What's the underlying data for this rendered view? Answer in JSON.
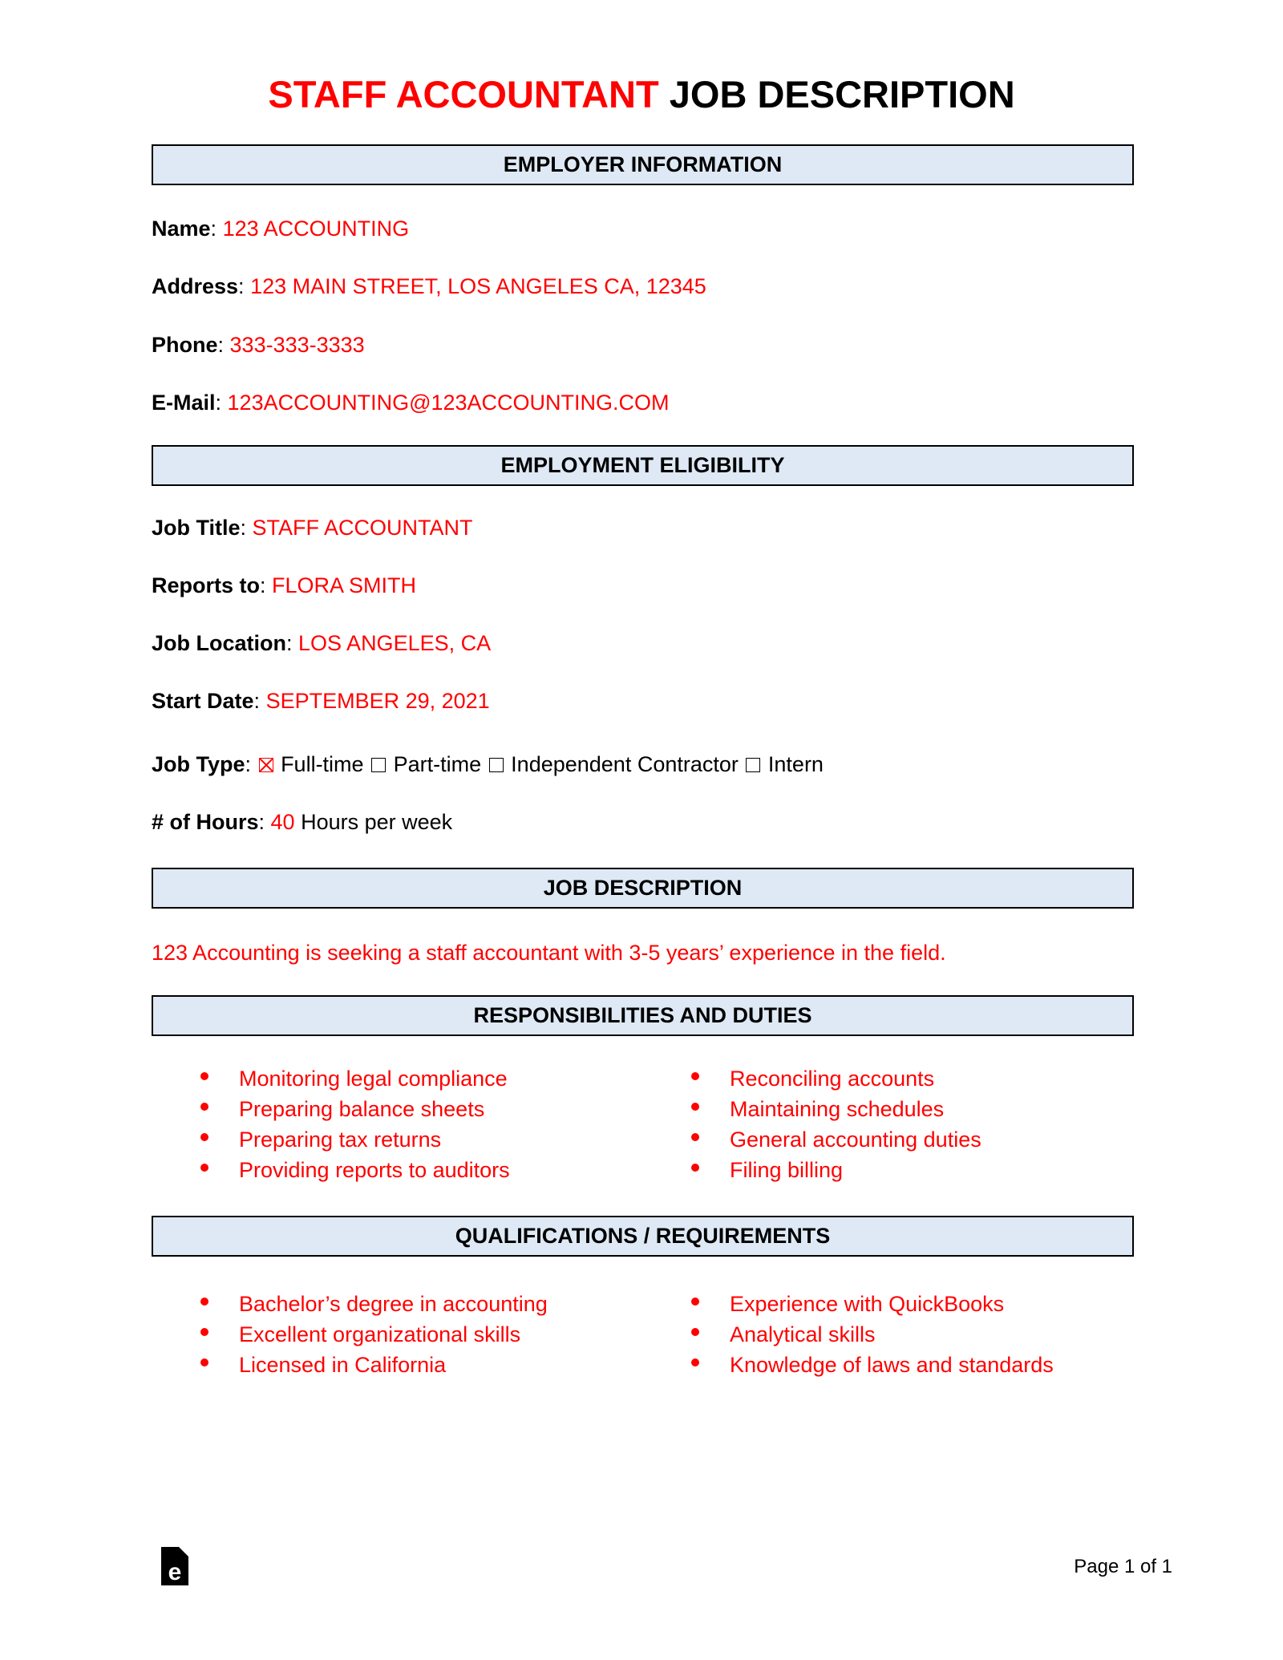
{
  "title": {
    "highlight": "STAFF ACCOUNTANT",
    "rest": " JOB DESCRIPTION"
  },
  "sections": {
    "employer": "EMPLOYER INFORMATION",
    "eligibility": "EMPLOYMENT ELIGIBILITY",
    "description": "JOB DESCRIPTION",
    "responsibilities": "RESPONSIBILITIES AND DUTIES",
    "qualifications": "QUALIFICATIONS / REQUIREMENTS"
  },
  "employer": {
    "name": {
      "label": "Name",
      "value": "123 ACCOUNTING"
    },
    "address": {
      "label": "Address",
      "value": "123 MAIN STREET, LOS ANGELES CA, 12345"
    },
    "phone": {
      "label": "Phone",
      "value": "333-333-3333"
    },
    "email": {
      "label": "E-Mail",
      "value": "123ACCOUNTING@123ACCOUNTING.COM"
    }
  },
  "eligibility": {
    "job_title": {
      "label": "Job Title",
      "value": "STAFF ACCOUNTANT"
    },
    "reports_to": {
      "label": "Reports to",
      "value": "FLORA SMITH"
    },
    "location": {
      "label": "Job Location",
      "value": "LOS ANGELES, CA"
    },
    "start_date": {
      "label": "Start Date",
      "value": "SEPTEMBER 29, 2021"
    },
    "job_type": {
      "label": "Job Type",
      "options": [
        {
          "label": "Full-time",
          "checked": true
        },
        {
          "label": "Part-time",
          "checked": false
        },
        {
          "label": "Independent Contractor",
          "checked": false
        },
        {
          "label": "Intern",
          "checked": false
        }
      ]
    },
    "hours": {
      "label": "# of Hours",
      "value": "40",
      "suffix": "Hours per week"
    }
  },
  "description": "123 Accounting is seeking a staff accountant with 3-5 years’ experience in the field.",
  "responsibilities": {
    "left": [
      "Monitoring legal compliance",
      "Preparing balance sheets",
      "Preparing tax returns",
      "Providing reports to auditors"
    ],
    "right": [
      "Reconciling accounts",
      "Maintaining schedules",
      "General accounting duties",
      "Filing billing"
    ]
  },
  "qualifications": {
    "left": [
      "Bachelor’s degree in accounting",
      "Excellent organizational skills",
      "Licensed in California"
    ],
    "right": [
      "Experience with QuickBooks",
      "Analytical skills",
      "Knowledge of laws and standards"
    ]
  },
  "footer": {
    "page_label": "Page 1 of 1",
    "logo_icon": "eforms-logo-icon"
  },
  "colors": {
    "accent": "#ff0000",
    "header_fill": "#dee9f5"
  }
}
